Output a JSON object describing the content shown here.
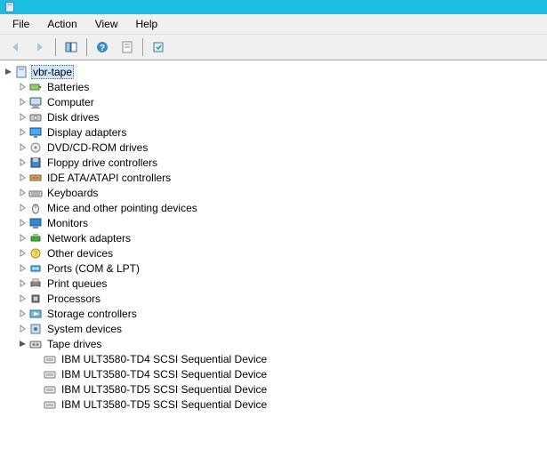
{
  "menu": {
    "file": "File",
    "action": "Action",
    "view": "View",
    "help": "Help"
  },
  "tree": {
    "root": {
      "label": "vbr-tape"
    },
    "categories": [
      {
        "label": "Batteries",
        "icon": "battery"
      },
      {
        "label": "Computer",
        "icon": "computer"
      },
      {
        "label": "Disk drives",
        "icon": "disk"
      },
      {
        "label": "Display adapters",
        "icon": "display"
      },
      {
        "label": "DVD/CD-ROM drives",
        "icon": "optical"
      },
      {
        "label": "Floppy drive controllers",
        "icon": "floppy"
      },
      {
        "label": "IDE ATA/ATAPI controllers",
        "icon": "ide"
      },
      {
        "label": "Keyboards",
        "icon": "keyboard"
      },
      {
        "label": "Mice and other pointing devices",
        "icon": "mouse"
      },
      {
        "label": "Monitors",
        "icon": "monitor"
      },
      {
        "label": "Network adapters",
        "icon": "network"
      },
      {
        "label": "Other devices",
        "icon": "other"
      },
      {
        "label": "Ports (COM & LPT)",
        "icon": "port"
      },
      {
        "label": "Print queues",
        "icon": "printer"
      },
      {
        "label": "Processors",
        "icon": "cpu"
      },
      {
        "label": "Storage controllers",
        "icon": "storage"
      },
      {
        "label": "System devices",
        "icon": "system"
      }
    ],
    "tape": {
      "label": "Tape drives",
      "children": [
        {
          "label": "IBM ULT3580-TD4 SCSI Sequential Device"
        },
        {
          "label": "IBM ULT3580-TD4 SCSI Sequential Device"
        },
        {
          "label": "IBM ULT3580-TD5 SCSI Sequential Device"
        },
        {
          "label": "IBM ULT3580-TD5 SCSI Sequential Device"
        }
      ]
    }
  }
}
